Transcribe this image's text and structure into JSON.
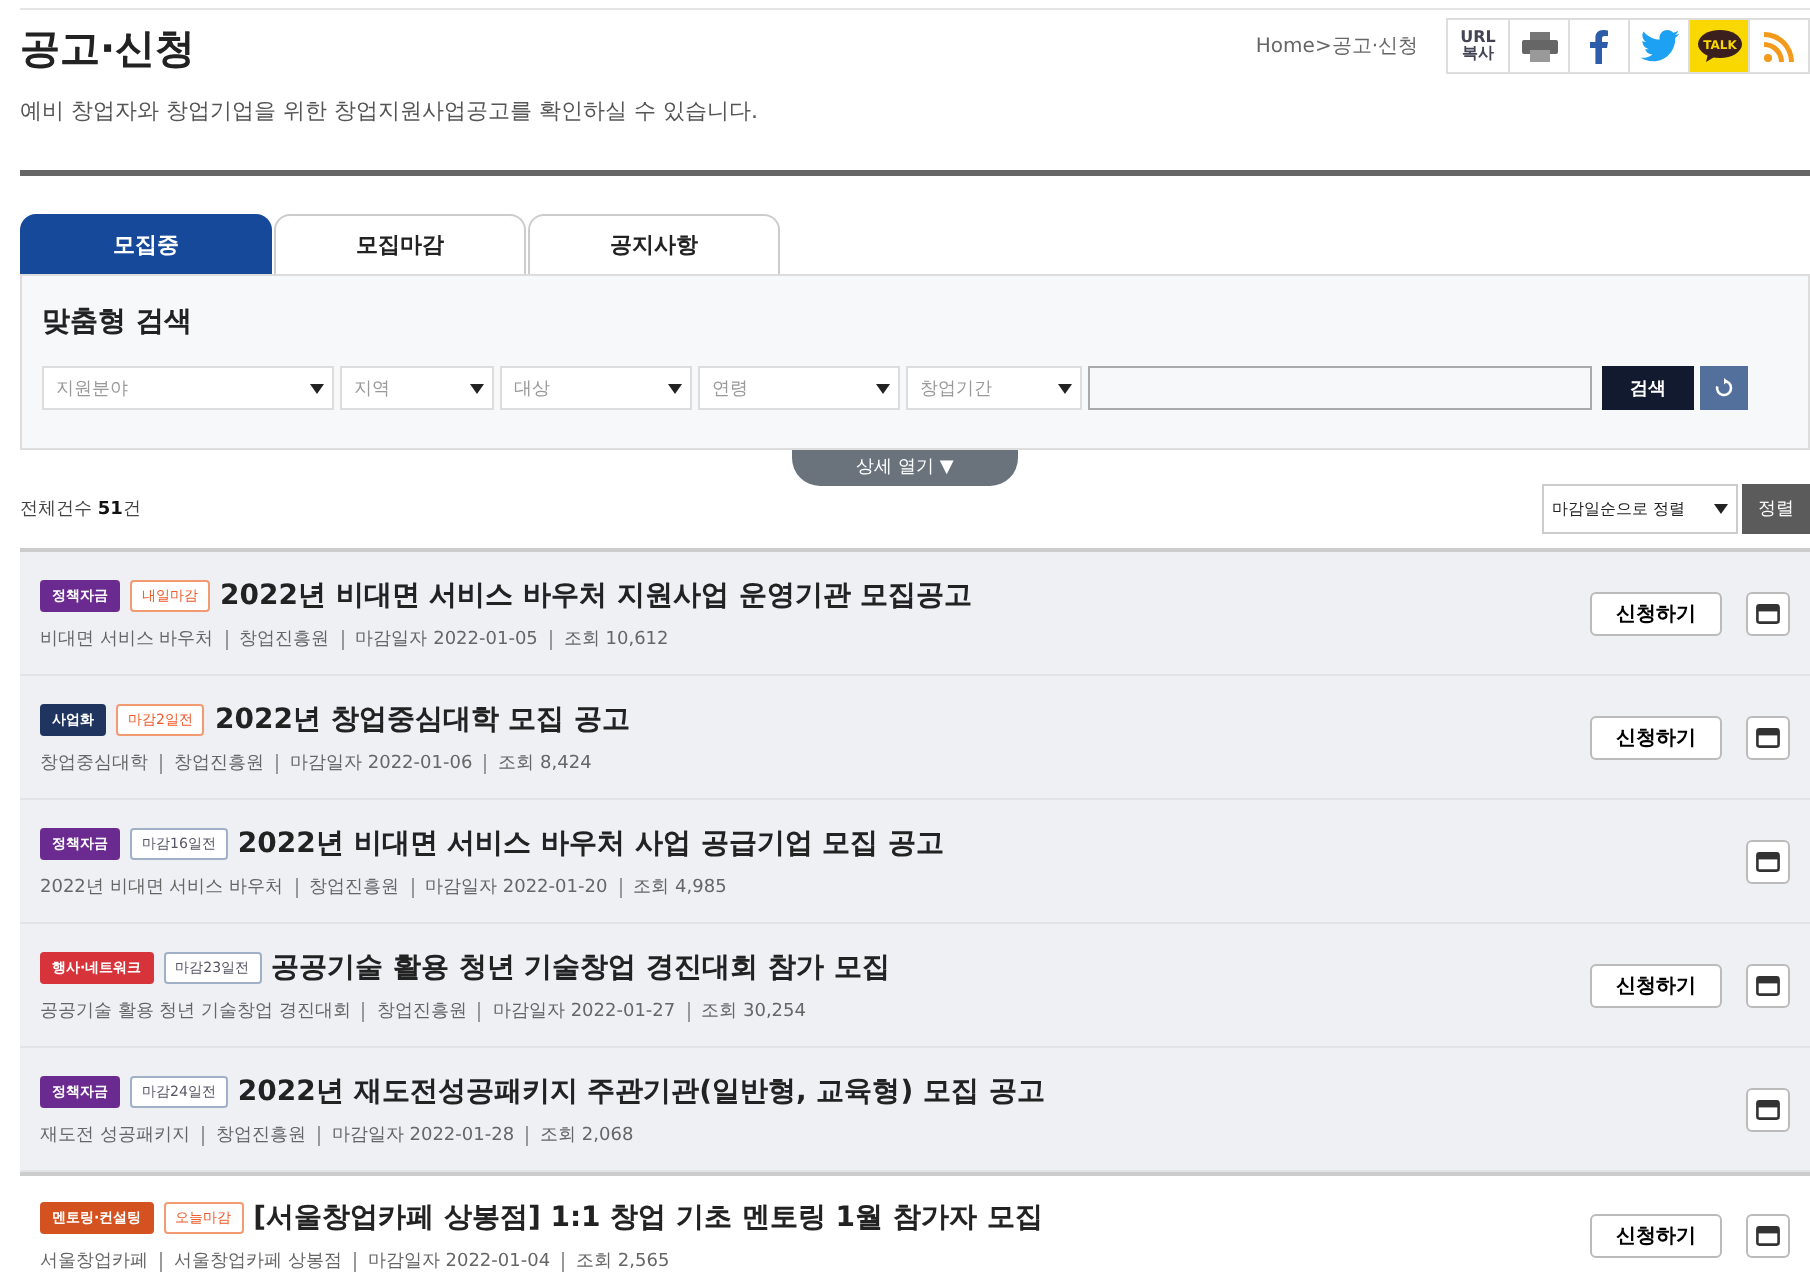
{
  "header": {
    "title": "공고·신청",
    "subtitle": "예비 창업자와 창업기업을 위한 창업지원사업공고를 확인하실 수 있습니다.",
    "breadcrumb": "Home>공고·신청",
    "share": [
      {
        "kind": "url",
        "label": "URL\n복사"
      },
      {
        "kind": "print"
      },
      {
        "kind": "facebook"
      },
      {
        "kind": "twitter"
      },
      {
        "kind": "talk",
        "label": "TALK"
      },
      {
        "kind": "rss"
      }
    ]
  },
  "tabs": [
    {
      "label": "모집중",
      "selected": true
    },
    {
      "label": "모집마감",
      "selected": false
    },
    {
      "label": "공지사항",
      "selected": false
    }
  ],
  "search": {
    "title": "맞춤형 검색",
    "filters": [
      {
        "placeholder": "지원분야"
      },
      {
        "placeholder": "지역"
      },
      {
        "placeholder": "대상"
      },
      {
        "placeholder": "연령"
      },
      {
        "placeholder": "창업기간"
      }
    ],
    "button": "검색",
    "toggle": "상세 열기 ▼"
  },
  "summary": {
    "label": "전체건수",
    "count": "51",
    "unit": "건"
  },
  "sort": {
    "value": "마감일순으로 정렬",
    "button": "정렬"
  },
  "items": [
    {
      "category": "정책자금",
      "color": "#6b2a8f",
      "deadline": "내일마감",
      "urgent": true,
      "title": "2022년 비대면 서비스 바우처 지원사업 운영기관 모집공고",
      "meta": [
        "비대면 서비스 바우처",
        "창업진흥원",
        "마감일자 2022-01-05",
        "조회 10,612"
      ],
      "apply": "신청하기",
      "shaded": true
    },
    {
      "category": "사업화",
      "color": "#1f3560",
      "deadline": "마감2일전",
      "urgent": true,
      "title": "2022년 창업중심대학 모집 공고",
      "meta": [
        "창업중심대학",
        "창업진흥원",
        "마감일자 2022-01-06",
        "조회 8,424"
      ],
      "apply": "신청하기",
      "shaded": true
    },
    {
      "category": "정책자금",
      "color": "#6b2a8f",
      "deadline": "마감16일전",
      "urgent": false,
      "title": "2022년 비대면 서비스 바우처 사업 공급기업 모집 공고",
      "meta": [
        "2022년 비대면 서비스 바우처",
        "창업진흥원",
        "마감일자 2022-01-20",
        "조회 4,985"
      ],
      "shaded": true
    },
    {
      "category": "행사·네트워크",
      "color": "#d6333b",
      "deadline": "마감23일전",
      "urgent": false,
      "title": "공공기술 활용 청년 기술창업 경진대회 참가 모집",
      "meta": [
        "공공기술 활용 청년 기술창업 경진대회",
        "창업진흥원",
        "마감일자 2022-01-27",
        "조회 30,254"
      ],
      "apply": "신청하기",
      "shaded": true
    },
    {
      "category": "정책자금",
      "color": "#6b2a8f",
      "deadline": "마감24일전",
      "urgent": false,
      "title": "2022년 재도전성공패키지 주관기관(일반형, 교육형) 모집 공고",
      "meta": [
        "재도전 성공패키지",
        "창업진흥원",
        "마감일자 2022-01-28",
        "조회 2,068"
      ],
      "shaded": true
    },
    {
      "category": "멘토링·컨설팅",
      "color": "#d4521f",
      "deadline": "오늘마감",
      "urgent": true,
      "title": "[서울창업카페 상봉점] 1:1 창업 기초 멘토링 1월 참가자 모집",
      "meta": [
        "서울창업카페",
        "서울창업카페 상봉점",
        "마감일자 2022-01-04",
        "조회 2,565"
      ],
      "apply": "신청하기",
      "shaded": false
    }
  ]
}
